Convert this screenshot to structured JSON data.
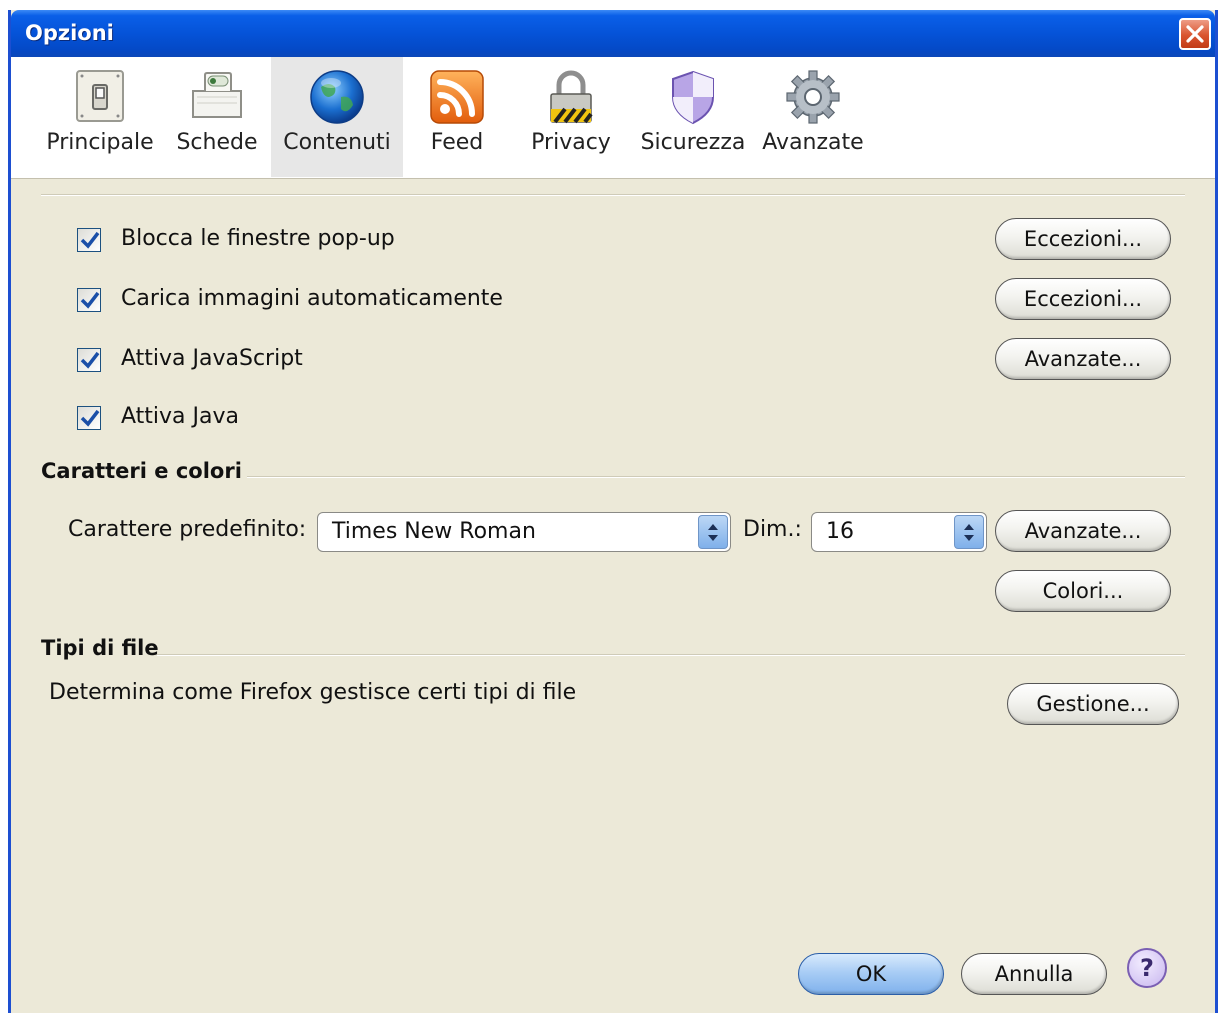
{
  "window": {
    "title": "Opzioni"
  },
  "tabs": [
    {
      "label": "Principale",
      "icon": "switch-icon"
    },
    {
      "label": "Schede",
      "icon": "tabs-icon"
    },
    {
      "label": "Contenuti",
      "icon": "globe-icon",
      "selected": true
    },
    {
      "label": "Feed",
      "icon": "rss-feed-icon"
    },
    {
      "label": "Privacy",
      "icon": "padlock-icon"
    },
    {
      "label": "Sicurezza",
      "icon": "shield-icon"
    },
    {
      "label": "Avanzate",
      "icon": "gear-icon"
    }
  ],
  "checkboxes": [
    {
      "label": "Blocca le finestre pop-up",
      "checked": true,
      "button": "Eccezioni..."
    },
    {
      "label": "Carica immagini automaticamente",
      "checked": true,
      "button": "Eccezioni..."
    },
    {
      "label": "Attiva JavaScript",
      "checked": true,
      "button": "Avanzate..."
    },
    {
      "label": "Attiva Java",
      "checked": true
    }
  ],
  "fonts": {
    "group_title": "Caratteri e colori",
    "default_font_label": "Carattere predefinito:",
    "default_font_value": "Times New Roman",
    "size_label": "Dim.:",
    "size_value": "16",
    "advanced_button": "Avanzate...",
    "colors_button": "Colori..."
  },
  "file_types": {
    "group_title": "Tipi di file",
    "description": "Determina come Firefox gestisce certi tipi di file",
    "manage_button": "Gestione..."
  },
  "footer": {
    "ok": "OK",
    "cancel": "Annulla",
    "help": "?"
  },
  "colors": {
    "titlebar": "#0553d8",
    "dialog_bg": "#ece9d8",
    "checkmark": "#1b4fa8",
    "close": "#d9542f"
  }
}
